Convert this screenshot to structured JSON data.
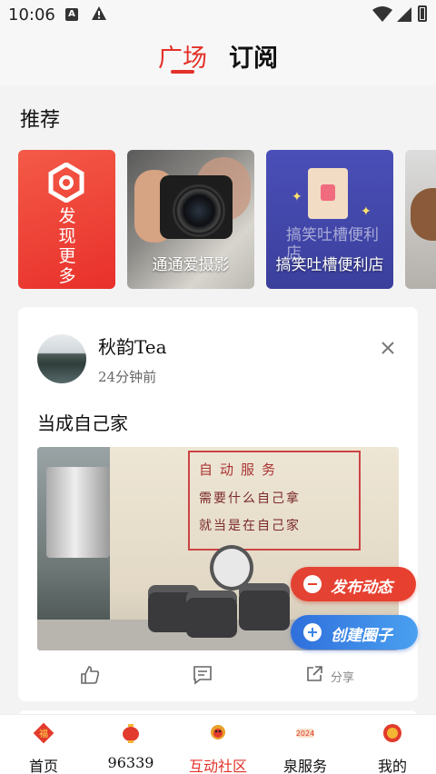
{
  "status_bar": {
    "time": "10:06"
  },
  "header": {
    "tabs": [
      {
        "label": "广场"
      },
      {
        "label": "订阅"
      }
    ]
  },
  "recommend": {
    "title": "推荐",
    "discover_label": "发现更多",
    "cards": [
      {
        "label": "通通爱摄影"
      },
      {
        "label": "搞笑吐槽便利店"
      }
    ],
    "joke_card_art_text": "搞笑吐槽便利店"
  },
  "post": {
    "author": "秋韵Tea",
    "time": "24分钟前",
    "text": "当成自己家",
    "image_sign": {
      "line1": "自动服务",
      "line2": "需要什么自己拿",
      "line3": "就当是在自己家"
    },
    "share_label": "分享"
  },
  "fab": {
    "publish": "发布动态",
    "create": "创建圈子"
  },
  "bottom_nav": {
    "items": [
      {
        "label": "首页"
      },
      {
        "label": "96339"
      },
      {
        "label": "互动社区"
      },
      {
        "label": "泉服务"
      },
      {
        "label": "我的"
      }
    ]
  },
  "colors": {
    "accent": "#e4312a",
    "blue": "#3a84e6"
  }
}
